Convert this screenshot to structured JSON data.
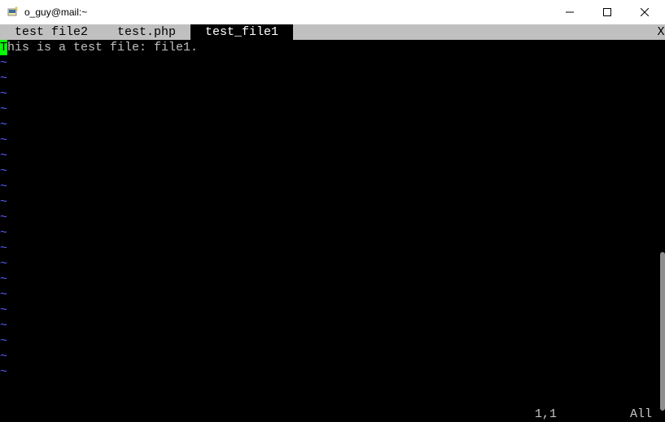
{
  "window": {
    "title": "o_guy@mail:~"
  },
  "tabs": [
    {
      "label": " test file2 ",
      "active": false
    },
    {
      "label": " test.php ",
      "active": false
    },
    {
      "label": " test_file1 ",
      "active": true
    }
  ],
  "tab_close_label": "X",
  "editor": {
    "cursor_char": "T",
    "line_rest": "his is a test file: file1.",
    "tilde": "~"
  },
  "status": {
    "position": "1,1",
    "percent": "All"
  }
}
